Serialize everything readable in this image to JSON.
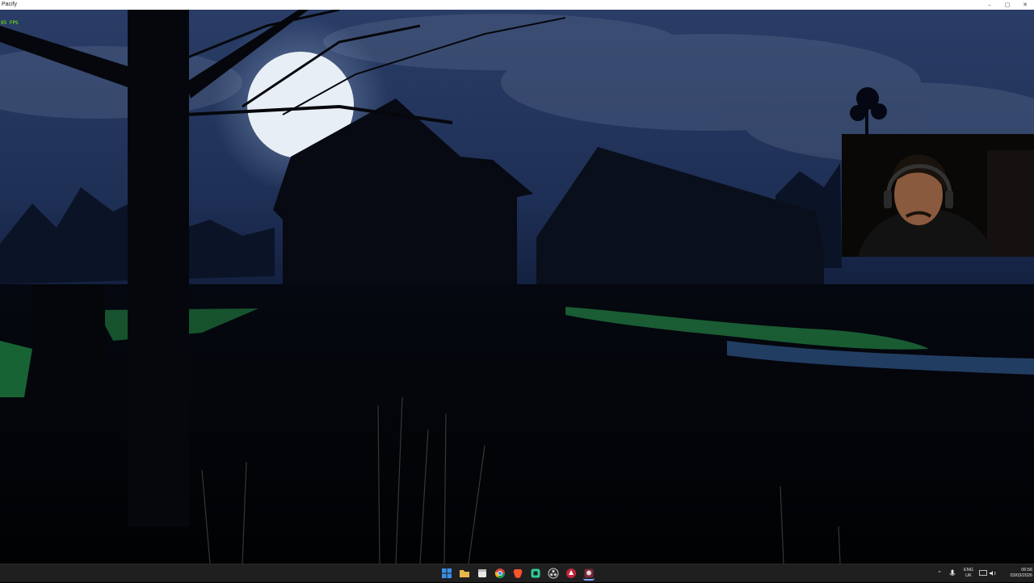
{
  "window": {
    "title": "Pacify",
    "controls": {
      "minimize": "–",
      "maximize": "▢",
      "close": "✕"
    }
  },
  "game": {
    "fps": "95 FPS",
    "scene": "night-farmhouse",
    "colors": {
      "sky": "#1e2f55",
      "moon": "#e8eef5",
      "grass": "#1f6b3a",
      "water": "#3f74b8"
    }
  },
  "taskbar": {
    "icons": [
      {
        "name": "windows-start-icon",
        "color": "#3a8ee6"
      },
      {
        "name": "file-explorer-icon",
        "color": "#e8b64a"
      },
      {
        "name": "calendar-app-icon",
        "color": "#e7e7e7"
      },
      {
        "name": "chrome-icon",
        "color": "#4c8bf5"
      },
      {
        "name": "brave-icon",
        "color": "#fb542b"
      },
      {
        "name": "green-app-icon",
        "color": "#2ecc9a"
      },
      {
        "name": "obs-icon",
        "color": "#cfcfcf"
      },
      {
        "name": "game-launcher-icon",
        "color": "#c3243a"
      },
      {
        "name": "pacify-game-icon",
        "color": "#7a2a3a"
      }
    ],
    "tray": {
      "chevron": "⌃",
      "language_top": "ENG",
      "language_bottom": "UK",
      "time": "06:56",
      "date": "03/03/2026"
    }
  }
}
